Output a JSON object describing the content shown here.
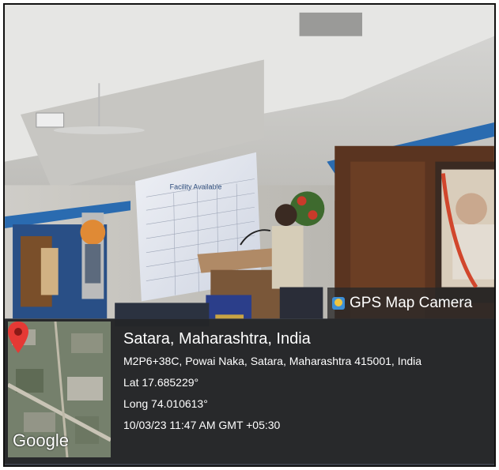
{
  "app": {
    "name": "GPS Map Camera",
    "icon": "gps-map-camera-icon"
  },
  "photo": {
    "slide_title": "Facility Available"
  },
  "location": {
    "place": "Satara, Maharashtra, India",
    "address": "M2P6+38C, Powai Naka, Satara, Maharashtra 415001, India",
    "lat": "Lat 17.685229°",
    "long": "Long 74.010613°",
    "datetime": "10/03/23 11:47 AM GMT +05:30"
  },
  "map": {
    "brand": "Google",
    "pin_color": "#e53935"
  }
}
